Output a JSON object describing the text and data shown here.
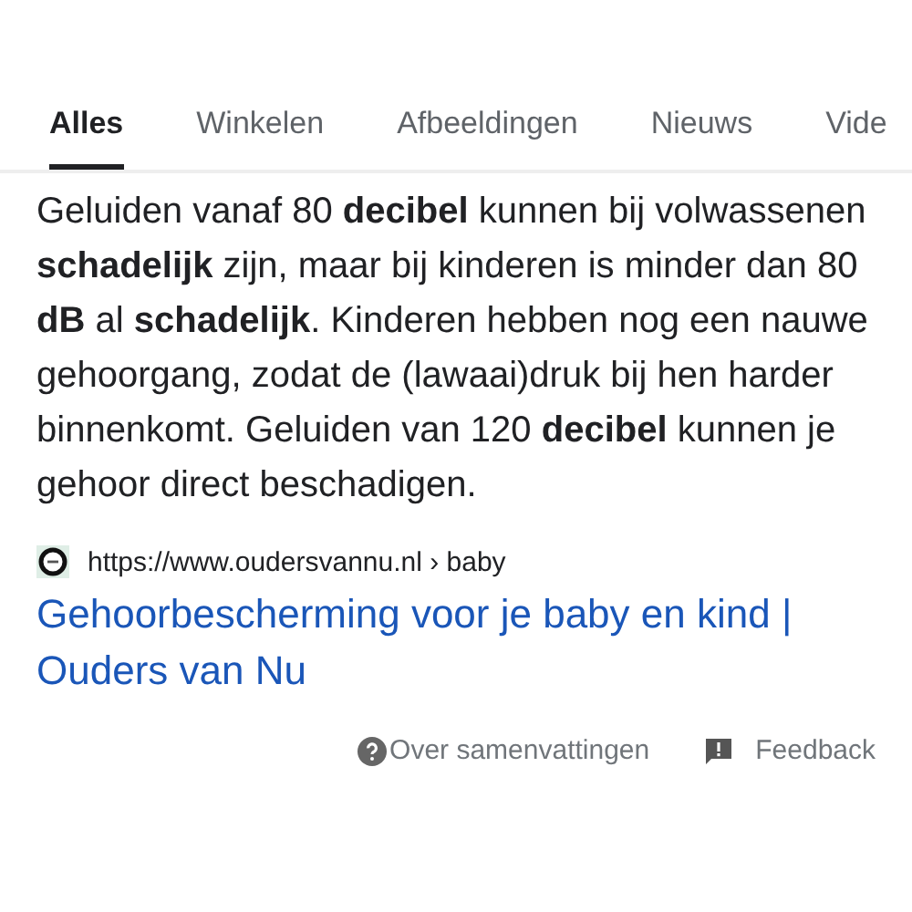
{
  "tabs": [
    {
      "label": "Alles",
      "selected": true
    },
    {
      "label": "Winkelen",
      "selected": false
    },
    {
      "label": "Afbeeldingen",
      "selected": false
    },
    {
      "label": "Nieuws",
      "selected": false
    },
    {
      "label": "Vide",
      "selected": false
    }
  ],
  "answer": {
    "text": "Geluiden vanaf 80 **decibel** kunnen bij volwassenen **schadelijk** zijn, maar bij kinderen is minder dan 80 **dB** al **schadelijk**. Kinderen hebben nog een nauwe gehoorgang, zodat de (lawaai)druk bij hen harder binnenkomt. Geluiden van 120 **decibel** kunnen je gehoor direct beschadigen."
  },
  "source": {
    "url": "https://www.oudersvannu.nl › baby",
    "title": "Gehoorbescherming voor je baby en kind | Ouders van Nu"
  },
  "footer": {
    "about": "Over samenvattingen",
    "feedback": "Feedback"
  }
}
